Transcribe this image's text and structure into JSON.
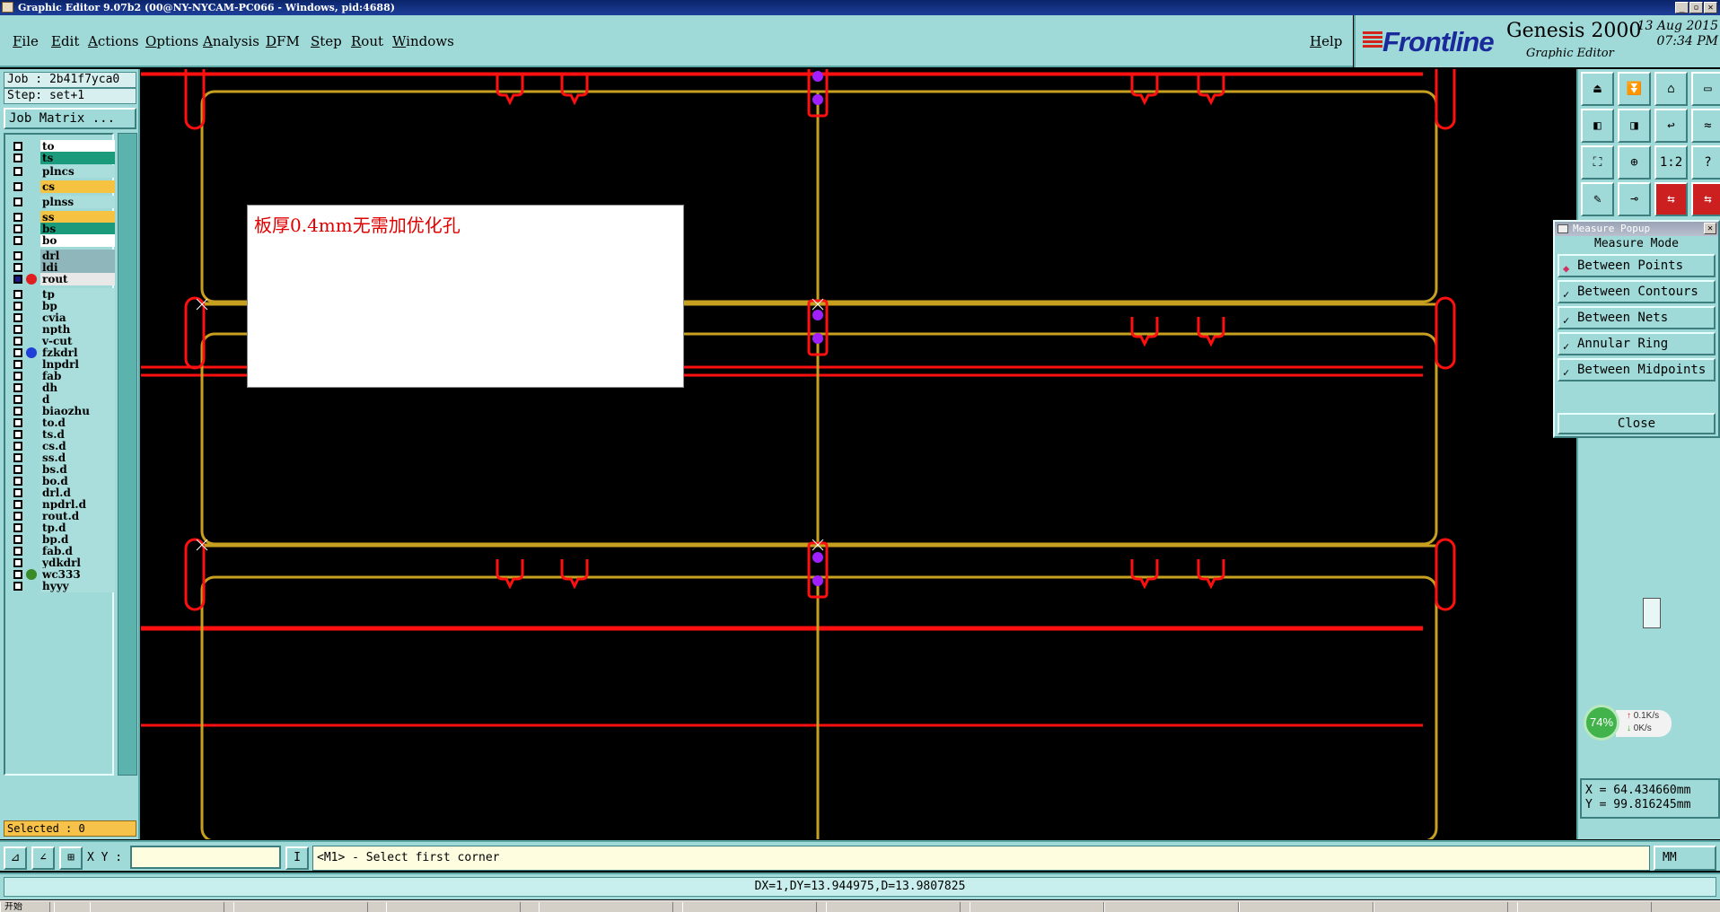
{
  "window": {
    "title": "Graphic Editor 9.07b2 (00@NY-NYCAM-PC066 - Windows, pid:4688)",
    "buttons": [
      "_",
      "▫",
      "✕"
    ]
  },
  "menu": {
    "items": [
      "File",
      "Edit",
      "Actions",
      "Options",
      "Analysis",
      "DFM",
      "Step",
      "Rout",
      "Windows"
    ],
    "help": "Help"
  },
  "brand": {
    "logo": "Frontline",
    "product": "Genesis 2000",
    "subtitle": "Graphic Editor",
    "date": "13 Aug 2015",
    "time": "07:34 PM",
    "colors": {
      "logo": "#1b2a9a",
      "stripes": "#d3241c"
    }
  },
  "left": {
    "job": "Job : 2b41f7yca0",
    "step": "Step: set+1",
    "job_matrix": "Job Matrix ...",
    "selected": "Selected : 0",
    "layers": [
      {
        "name": "to",
        "bg": "#ffffff",
        "dot": ""
      },
      {
        "name": "ts",
        "bg": "#1c9a7c",
        "dot": ""
      },
      {
        "name": "plncs",
        "bg": "#a9dedd",
        "dot": ""
      },
      {
        "name": "cs",
        "bg": "#f5c242",
        "dot": ""
      },
      {
        "name": "plnss",
        "bg": "#a9dedd",
        "dot": ""
      },
      {
        "name": "ss",
        "bg": "#f5c242",
        "dot": ""
      },
      {
        "name": "bs",
        "bg": "#1c9a7c",
        "dot": ""
      },
      {
        "name": "bo",
        "bg": "#ffffff",
        "dot": ""
      },
      {
        "name": "drl",
        "bg": "#8fb6bb",
        "dot": ""
      },
      {
        "name": "ldi",
        "bg": "#8fb6bb",
        "dot": ""
      },
      {
        "name": "rout",
        "bg": "#e8e8e8",
        "dot": "#e02020"
      },
      {
        "name": "tp",
        "bg": "#a9dedd",
        "dot": ""
      },
      {
        "name": "bp",
        "bg": "#a9dedd",
        "dot": ""
      },
      {
        "name": "cvia",
        "bg": "#a9dedd",
        "dot": ""
      },
      {
        "name": "npth",
        "bg": "#a9dedd",
        "dot": ""
      },
      {
        "name": "v-cut",
        "bg": "#a9dedd",
        "dot": ""
      },
      {
        "name": "fzkdrl",
        "bg": "#a9dedd",
        "dot": "#1f3fd8"
      },
      {
        "name": "lnpdrl",
        "bg": "#a9dedd",
        "dot": ""
      },
      {
        "name": "fab",
        "bg": "#a9dedd",
        "dot": ""
      },
      {
        "name": "dh",
        "bg": "#a9dedd",
        "dot": ""
      },
      {
        "name": "d",
        "bg": "#a9dedd",
        "dot": ""
      },
      {
        "name": "biaozhu",
        "bg": "#a9dedd",
        "dot": ""
      },
      {
        "name": "to.d",
        "bg": "#a9dedd",
        "dot": ""
      },
      {
        "name": "ts.d",
        "bg": "#a9dedd",
        "dot": ""
      },
      {
        "name": "cs.d",
        "bg": "#a9dedd",
        "dot": ""
      },
      {
        "name": "ss.d",
        "bg": "#a9dedd",
        "dot": ""
      },
      {
        "name": "bs.d",
        "bg": "#a9dedd",
        "dot": ""
      },
      {
        "name": "bo.d",
        "bg": "#a9dedd",
        "dot": ""
      },
      {
        "name": "drl.d",
        "bg": "#a9dedd",
        "dot": ""
      },
      {
        "name": "npdrl.d",
        "bg": "#a9dedd",
        "dot": ""
      },
      {
        "name": "rout.d",
        "bg": "#a9dedd",
        "dot": ""
      },
      {
        "name": "tp.d",
        "bg": "#a9dedd",
        "dot": ""
      },
      {
        "name": "bp.d",
        "bg": "#a9dedd",
        "dot": ""
      },
      {
        "name": "fab.d",
        "bg": "#a9dedd",
        "dot": ""
      },
      {
        "name": "ydkdrl",
        "bg": "#a9dedd",
        "dot": ""
      },
      {
        "name": "wc333",
        "bg": "#a9dedd",
        "dot": "#3b8a2a"
      },
      {
        "name": "hyyy",
        "bg": "#a9dedd",
        "dot": ""
      }
    ]
  },
  "canvas": {
    "note": "板厚0.4mm无需加优化孔",
    "colors": {
      "rout": "#ff1010",
      "profile": "#c8a020",
      "drill": "#a020ff",
      "background": "#000000"
    }
  },
  "right": {
    "tool_icons": [
      "zoom-home-icon",
      "zoom-in-icon",
      "home-icon",
      "window-icon",
      "pan-left-icon",
      "pan-right-icon",
      "undo-view-icon",
      "redraw-icon",
      "fit-icon",
      "fit-profile-icon",
      "one-to-two-icon",
      "help-icon",
      "measure-icon",
      "snap-icon",
      "layer-toggle-icon",
      "layer-toggle2-icon"
    ],
    "tool_glyphs": [
      "⏏",
      "⏬",
      "⌂",
      "▭",
      "◧",
      "◨",
      "↩",
      "≈",
      "⛶",
      "⊕",
      "1:2",
      "?",
      "✎",
      "⊸",
      "⇆",
      "⇆"
    ],
    "net_percent": "74%",
    "up_rate": "0.1K/s",
    "down_rate": "0K/s",
    "x": "X = 64.434660mm",
    "y": "Y = 99.816245mm"
  },
  "measure": {
    "title": "Measure Popup",
    "mode_label": "Measure Mode",
    "options": [
      "Between Points",
      "Between Contours",
      "Between Nets",
      "Annular Ring",
      "Between Midpoints"
    ],
    "selected": "Between Points",
    "close": "Close"
  },
  "command": {
    "xy_label": "X Y :",
    "xy_value": "",
    "prompt": "<M1> - Select first corner",
    "units": "MM",
    "delta": "DX=1,DY=13.944975,D=13.9807825"
  },
  "taskbar": {
    "items": [
      "开始",
      "",
      "",
      "",
      "",
      "",
      "",
      "",
      "",
      "",
      "",
      "",
      ""
    ]
  }
}
